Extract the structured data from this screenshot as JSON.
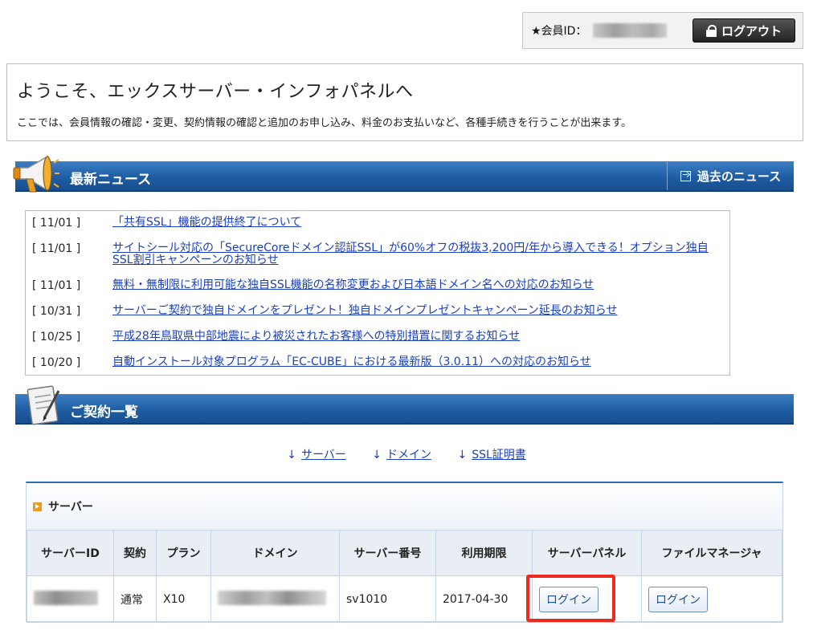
{
  "member": {
    "id_label": "★会員ID：",
    "logout_label": "ログアウト"
  },
  "welcome": {
    "title": "ようこそ、エックスサーバー・インフォパネルへ",
    "description": "ここでは、会員情報の確認・変更、契約情報の確認と追加のお申し込み、料金のお支払いなど、各種手続きを行うことが出来ます。"
  },
  "news": {
    "title": "最新ニュース",
    "past_label": "過去のニュース",
    "items": [
      {
        "date": "[ 11/01 ]",
        "text": "「共有SSL」機能の提供終了について"
      },
      {
        "date": "[ 11/01 ]",
        "text": "サイトシール対応の「SecureCoreドメイン認証SSL」が60%オフの税抜3,200円/年から導入できる！オプション独自SSL割引キャンペーンのお知らせ"
      },
      {
        "date": "[ 11/01 ]",
        "text": "無料・無制限に利用可能な独自SSL機能の名称変更および日本語ドメイン名への対応のお知らせ"
      },
      {
        "date": "[ 10/31 ]",
        "text": "サーバーご契約で独自ドメインをプレゼント！独自ドメインプレゼントキャンペーン延長のお知らせ"
      },
      {
        "date": "[ 10/25 ]",
        "text": "平成28年鳥取県中部地震により被災されたお客様への特別措置に関するお知らせ"
      },
      {
        "date": "[ 10/20 ]",
        "text": "自動インストール対象プログラム「EC-CUBE」における最新版（3.0.11）への対応のお知らせ"
      }
    ]
  },
  "contracts": {
    "title": "ご契約一覧",
    "anchors": [
      {
        "arrow": "↓",
        "label": "サーバー"
      },
      {
        "arrow": "↓",
        "label": "ドメイン"
      },
      {
        "arrow": "↓",
        "label": "SSL証明書"
      }
    ]
  },
  "server": {
    "caption": "サーバー",
    "headers": [
      "サーバーID",
      "契約",
      "プラン",
      "ドメイン",
      "サーバー番号",
      "利用期限",
      "サーバーパネル",
      "ファイルマネージャ"
    ],
    "row": {
      "contract": "通常",
      "plan": "X10",
      "server_number": "sv1010",
      "expiry": "2017-04-30",
      "panel_login": "ログイン",
      "fm_login": "ログイン"
    }
  },
  "colors": {
    "header_blue": "#1f5da3",
    "link_blue": "#1a3fbf",
    "highlight_red": "#ee2a1f",
    "icon_orange": "#f19a1a"
  }
}
